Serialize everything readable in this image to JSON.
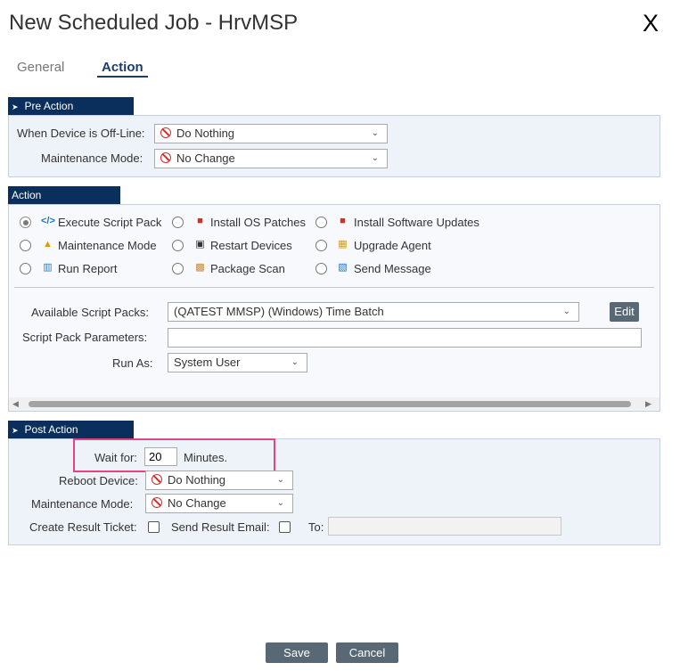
{
  "dialog": {
    "title": "New Scheduled Job - HrvMSP",
    "close_label": "X"
  },
  "tabs": [
    {
      "label": "General",
      "active": false
    },
    {
      "label": "Action",
      "active": true
    }
  ],
  "pre_action": {
    "header": "Pre Action",
    "offline_label": "When Device is Off-Line:",
    "offline_value": "Do Nothing",
    "maintenance_label": "Maintenance Mode:",
    "maintenance_value": "No Change"
  },
  "action": {
    "header": "Action",
    "options": [
      {
        "label": "Execute Script Pack",
        "icon": "code-icon",
        "checked": true
      },
      {
        "label": "Install OS Patches",
        "icon": "patch-icon",
        "checked": false
      },
      {
        "label": "Install Software Updates",
        "icon": "software-update-icon",
        "checked": false
      },
      {
        "label": "Maintenance Mode",
        "icon": "maintenance-icon",
        "checked": false
      },
      {
        "label": "Restart Devices",
        "icon": "restart-icon",
        "checked": false
      },
      {
        "label": "Upgrade Agent",
        "icon": "upgrade-agent-icon",
        "checked": false
      },
      {
        "label": "Run Report",
        "icon": "report-icon",
        "checked": false
      },
      {
        "label": "Package Scan",
        "icon": "package-icon",
        "checked": false
      },
      {
        "label": "Send Message",
        "icon": "message-icon",
        "checked": false
      }
    ],
    "script_packs_label": "Available Script Packs:",
    "script_packs_value": "(QATEST MMSP) (Windows) Time Batch",
    "edit_label": "Edit",
    "params_label": "Script Pack Parameters:",
    "params_value": "",
    "run_as_label": "Run As:",
    "run_as_value": "System User"
  },
  "post_action": {
    "header": "Post Action",
    "wait_label": "Wait for:",
    "wait_value": "20",
    "wait_unit": "Minutes.",
    "reboot_label": "Reboot Device:",
    "reboot_value": "Do Nothing",
    "maintenance_label": "Maintenance Mode:",
    "maintenance_value": "No Change",
    "ticket_label": "Create Result Ticket:",
    "email_label": "Send Result Email:",
    "to_label": "To:",
    "to_value": ""
  },
  "footer": {
    "save_label": "Save",
    "cancel_label": "Cancel"
  },
  "colors": {
    "section_header": "#0b2f5c",
    "panel_bg": "#eef3f9",
    "button": "#586874",
    "highlight": "#e24582",
    "stop_icon": "#d32f2f"
  }
}
